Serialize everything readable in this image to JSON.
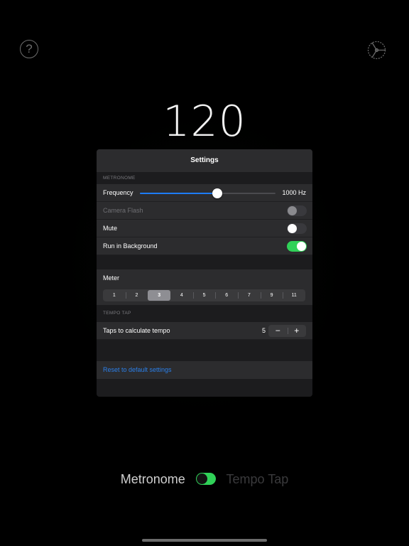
{
  "help_icon_glyph": "?",
  "tempo": {
    "value": "120"
  },
  "settings": {
    "title": "Settings",
    "metronome_section": "METRONOME",
    "frequency": {
      "label": "Frequency",
      "value_text": "1000 Hz",
      "slider_fraction": 0.57
    },
    "camera_flash": {
      "label": "Camera Flash",
      "on": false,
      "enabled": false
    },
    "mute": {
      "label": "Mute",
      "on": false
    },
    "run_in_background": {
      "label": "Run in Background",
      "on": true
    },
    "meter": {
      "label": "Meter",
      "options": [
        "1",
        "2",
        "3",
        "4",
        "5",
        "6",
        "7",
        "9",
        "11"
      ],
      "selected": "3"
    },
    "tempo_tap_section": "TEMPO TAP",
    "taps": {
      "label": "Taps to calculate tempo",
      "value": "5",
      "minus": "−",
      "plus": "+"
    },
    "reset_label": "Reset to default settings"
  },
  "mode": {
    "left": "Metronome",
    "right": "Tempo Tap",
    "on": true
  },
  "colors": {
    "accent_blue": "#1e7cf5",
    "toggle_green": "#30d158",
    "link_blue": "#2b7fe8"
  }
}
